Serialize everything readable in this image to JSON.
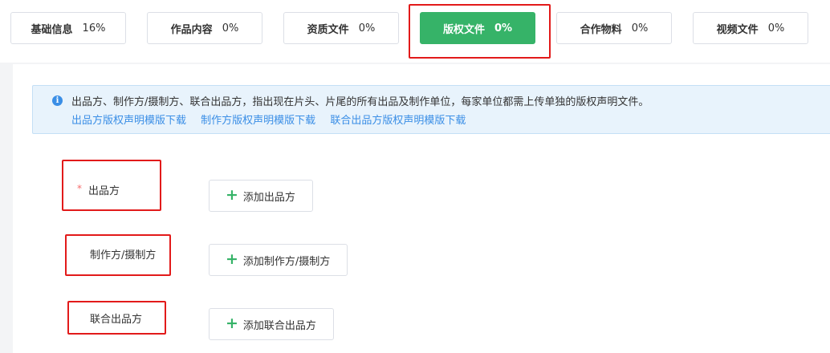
{
  "tabs": [
    {
      "label": "基础信息",
      "percent": "16%"
    },
    {
      "label": "作品内容",
      "percent": "0%"
    },
    {
      "label": "资质文件",
      "percent": "0%"
    },
    {
      "label": "版权文件",
      "percent": "0%"
    },
    {
      "label": "合作物料",
      "percent": "0%"
    },
    {
      "label": "视频文件",
      "percent": "0%"
    }
  ],
  "notice": {
    "icon": "info-icon",
    "text": "出品方、制作方/摄制方、联合出品方，指出现在片头、片尾的所有出品及制作单位，每家单位都需上传单独的版权声明文件。",
    "links": [
      "出品方版权声明模版下载",
      "制作方版权声明模版下载",
      "联合出品方版权声明模版下载"
    ]
  },
  "form": {
    "required_mark": "*",
    "producer": {
      "label": "出品方",
      "button": "添加出品方"
    },
    "maker": {
      "label": "制作方/摄制方",
      "button": "添加制作方/摄制方"
    },
    "co_producer": {
      "label": "联合出品方",
      "button": "添加联合出品方"
    }
  },
  "colors": {
    "accent": "#36b368",
    "link": "#3a8ee6",
    "highlight": "#e21a1a",
    "required": "#f56c6c"
  }
}
